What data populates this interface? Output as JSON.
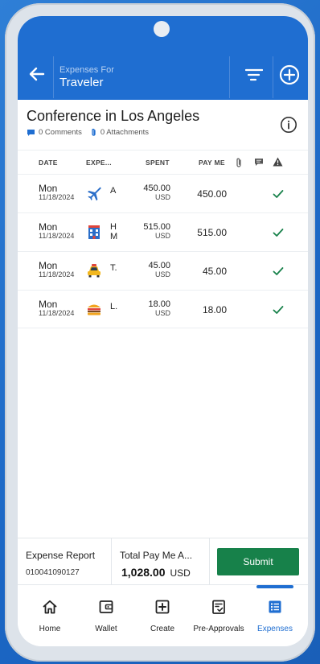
{
  "header": {
    "subtitle": "Expenses For",
    "title": "Traveler"
  },
  "report": {
    "title": "Conference in Los Angeles",
    "comments": "0 Comments",
    "attachments": "0 Attachments"
  },
  "table": {
    "columns": {
      "date": "DATE",
      "expense": "EXPE...",
      "spent": "SPENT",
      "payme": "PAY ME"
    },
    "rows": [
      {
        "day": "Mon",
        "date": "11/18/2024",
        "icon": "airplane-icon",
        "type": "A",
        "spent": "450.00",
        "currency": "USD",
        "payme": "450.00"
      },
      {
        "day": "Mon",
        "date": "11/18/2024",
        "icon": "hotel-icon",
        "type": "H\nM",
        "spent": "515.00",
        "currency": "USD",
        "payme": "515.00"
      },
      {
        "day": "Mon",
        "date": "11/18/2024",
        "icon": "taxi-icon",
        "type": "T.",
        "spent": "45.00",
        "currency": "USD",
        "payme": "45.00"
      },
      {
        "day": "Mon",
        "date": "11/18/2024",
        "icon": "meal-icon",
        "type": "L.",
        "spent": "18.00",
        "currency": "USD",
        "payme": "18.00"
      }
    ]
  },
  "footer": {
    "report_label": "Expense Report",
    "report_number": "010041090127",
    "total_label": "Total Pay Me A...",
    "total_value": "1,028.00",
    "total_currency": "USD",
    "submit_label": "Submit"
  },
  "tabs": [
    {
      "label": "Home",
      "icon": "home-icon"
    },
    {
      "label": "Wallet",
      "icon": "wallet-icon"
    },
    {
      "label": "Create",
      "icon": "plus-square-icon"
    },
    {
      "label": "Pre-Approvals",
      "icon": "clipboard-check-icon"
    },
    {
      "label": "Expenses",
      "icon": "list-icon",
      "active": true
    }
  ],
  "colors": {
    "brand": "#1f6ed1",
    "submit": "#17814a",
    "check": "#17814a"
  }
}
